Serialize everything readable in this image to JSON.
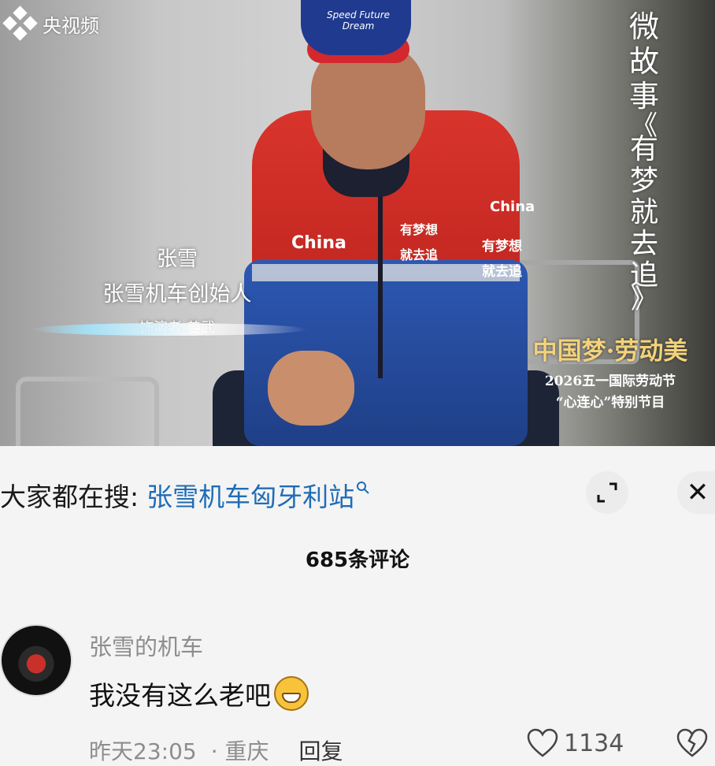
{
  "video": {
    "channel_logo": "央视频",
    "cap_text": [
      "Speed Future",
      "Dream"
    ],
    "jacket_texts": [
      "China",
      "有梦想",
      "就去追",
      "China",
      "有梦想",
      "就去追"
    ],
    "role_name": "张雪",
    "role_title": "张雪机车创始人",
    "actor_label": "饰演者  姜武",
    "series_title": "微故事",
    "series_name": [
      "《",
      "有",
      "梦",
      "就",
      "去",
      "追",
      "》"
    ],
    "event_title": "中国梦·劳动美",
    "event_line1": "2026五一国际劳动节",
    "event_line2": "“心连心”特别节目"
  },
  "panel": {
    "search_prefix": "大家都在搜:",
    "search_query": "张雪机车匈牙利站",
    "search_icon": "search-icon",
    "expand_icon": "expand-icon",
    "close_icon": "close-icon",
    "close_glyph": "✕",
    "comment_count": "685条评论"
  },
  "comment": {
    "user": "张雪的机车",
    "text": "我没有这么老吧",
    "emoji": "grinning-emoji",
    "time": "昨天23:05",
    "location": "· 重庆",
    "reply_label": "回复",
    "likes": "1134",
    "like_icon": "heart-icon",
    "dislike_icon": "broken-heart-icon"
  },
  "colors": {
    "link": "#1f6db6",
    "accent_gold": "#f3d27a"
  }
}
